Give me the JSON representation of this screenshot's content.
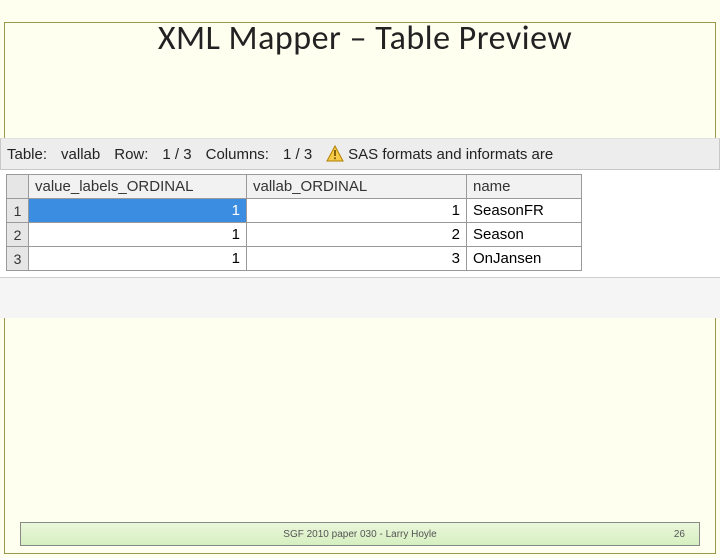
{
  "title": "XML Mapper – Table Preview",
  "status": {
    "table_label": "Table:",
    "table_name": "vallab",
    "row_label": "Row:",
    "row_value": "1 / 3",
    "col_label": "Columns:",
    "col_value": "1 / 3",
    "warning_text": "SAS formats and informats are"
  },
  "columns": [
    {
      "header": "value_labels_ORDINAL"
    },
    {
      "header": "vallab_ORDINAL"
    },
    {
      "header": "name"
    }
  ],
  "rows": [
    {
      "n": "1",
      "cells": [
        "1",
        "1",
        "SeasonFR"
      ],
      "selected": 0
    },
    {
      "n": "2",
      "cells": [
        "1",
        "2",
        "Season"
      ]
    },
    {
      "n": "3",
      "cells": [
        "1",
        "3",
        "OnJansen"
      ]
    }
  ],
  "footer": {
    "text": "SGF 2010 paper 030 - Larry Hoyle",
    "page": "26"
  }
}
